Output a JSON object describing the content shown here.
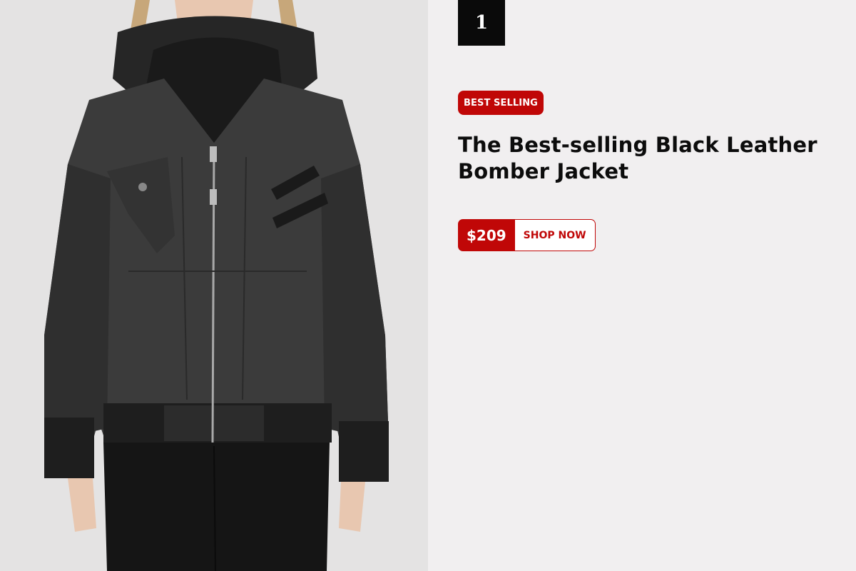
{
  "product": {
    "rank": "1",
    "badge": "BEST SELLING",
    "title": "The Best-selling Black Leather Bomber Jacket",
    "price": "$209",
    "cta_label": "SHOP NOW"
  },
  "colors": {
    "accent": "#c00707",
    "rank_bg": "#0a0a0a",
    "panel_bg": "#f1eff0",
    "photo_bg": "#e4e3e3"
  },
  "icons": {
    "photo": "leather-jacket-model-photo"
  }
}
